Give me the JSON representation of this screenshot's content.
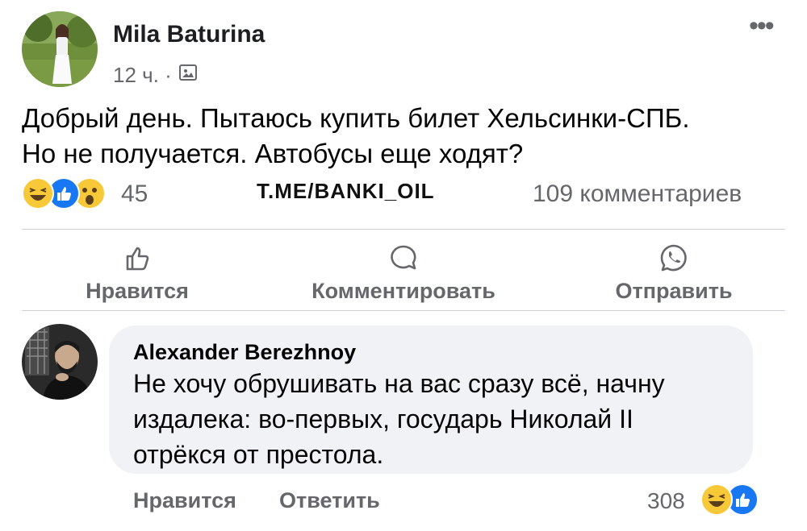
{
  "post": {
    "author": "Mila Baturina",
    "time": "12 ч. ·",
    "body_lines": [
      "Добрый день. Пытаюсь купить билет Хельсинки-СПБ.",
      "Но не получается. Автобусы еще ходят?"
    ],
    "reaction_count": "45",
    "comment_count": "109 комментариев",
    "more_icon": "more-horizontal-icon",
    "audience_icon": "photo-audience-icon"
  },
  "watermark": "T.ME/BANKI_OIL",
  "actions": {
    "like": "Нравится",
    "comment": "Комментировать",
    "share": "Отправить"
  },
  "comment": {
    "author": "Alexander Berezhnoy",
    "lines": [
      "Не хочу обрушивать на вас сразу всё, начну",
      "издалека: во-первых, государь Николай II",
      "отрёкся от престола."
    ],
    "like": "Нравится",
    "reply": "Ответить",
    "reaction_count": "308"
  },
  "colors": {
    "secondary_text": "#65676b",
    "bubble_bg": "#f0f2f5",
    "like_blue": "#1877f2",
    "emoji_yellow": "#f7c838"
  }
}
